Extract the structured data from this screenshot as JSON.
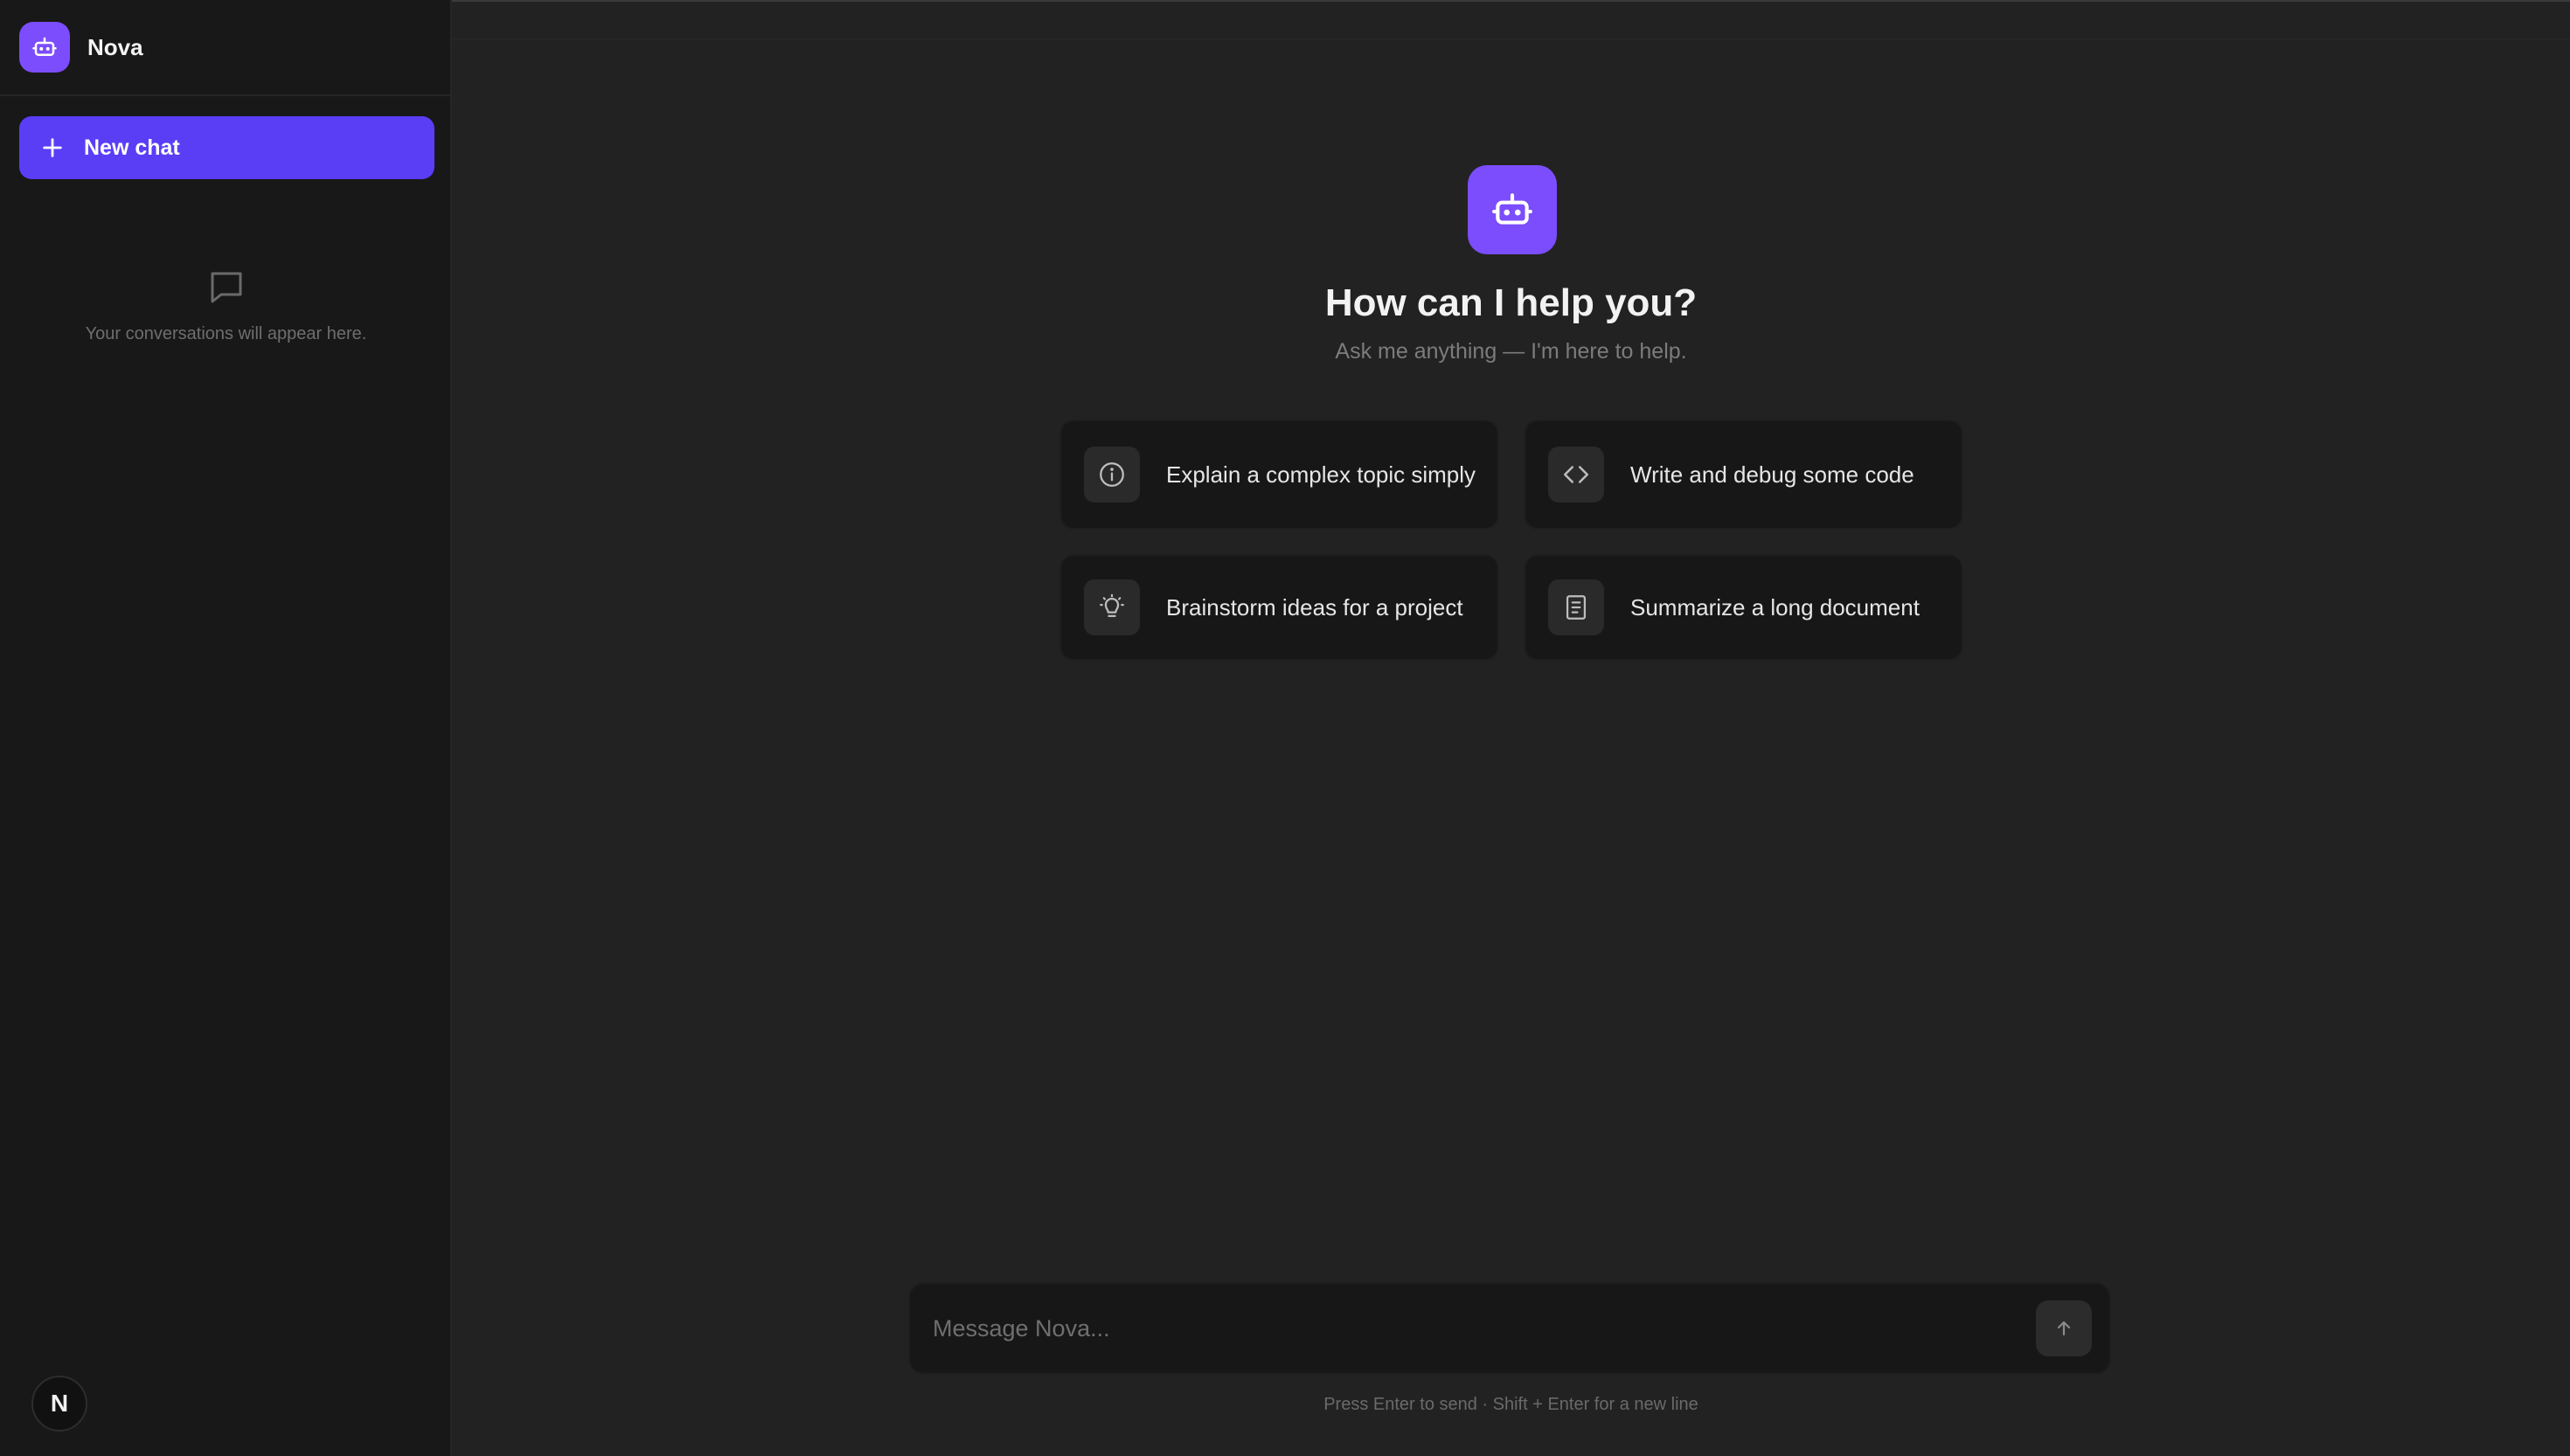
{
  "sidebar": {
    "brand_name": "Nova",
    "new_chat_label": "New chat",
    "empty_text": "Your conversations will appear here.",
    "user_initial": "N"
  },
  "main": {
    "title": "How can I help you?",
    "subtitle": "Ask me anything — I'm here to help.",
    "suggestions": [
      {
        "label": "Explain a complex topic simply",
        "icon": "info-icon"
      },
      {
        "label": "Write and debug some code",
        "icon": "code-icon"
      },
      {
        "label": "Brainstorm ideas for a project",
        "icon": "lightbulb-icon"
      },
      {
        "label": "Summarize a long document",
        "icon": "document-icon"
      }
    ]
  },
  "composer": {
    "placeholder": "Message Nova...",
    "hint": "Press Enter to send · Shift + Enter for a new line"
  },
  "colors": {
    "accent": "#5a3ef6",
    "logo": "#7b4dfc",
    "background": "#222222",
    "sidebar": "#181818",
    "card": "#171717"
  }
}
